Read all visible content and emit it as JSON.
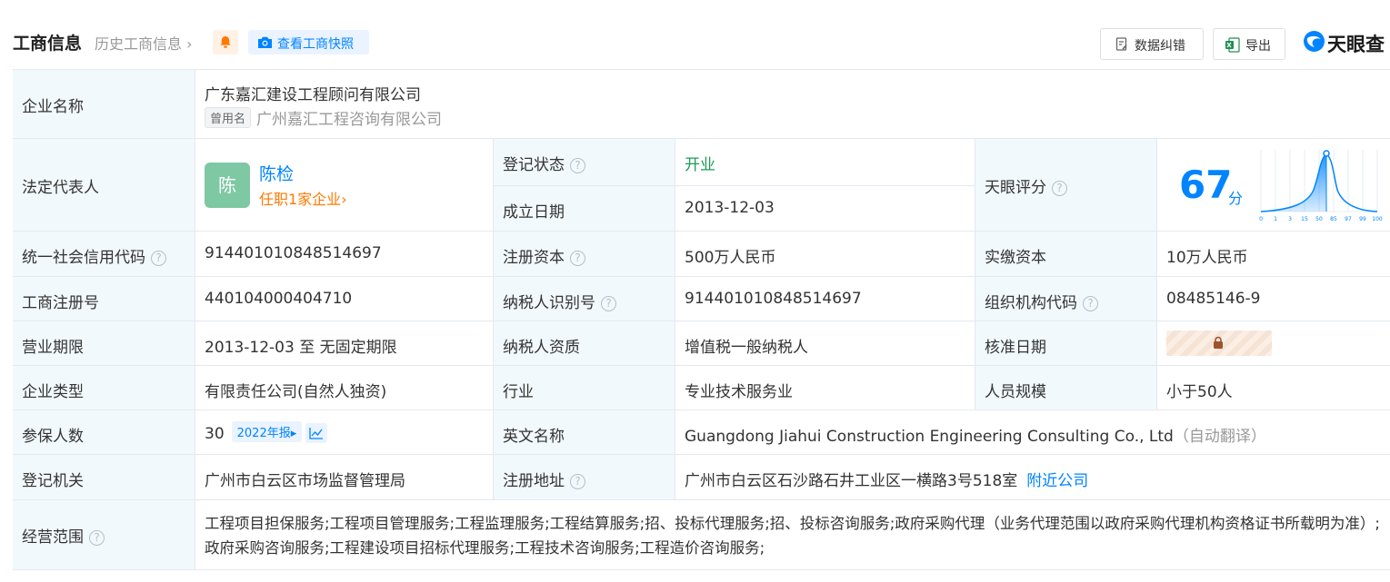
{
  "header": {
    "title": "工商信息",
    "history": "历史工商信息",
    "snapshot": "查看工商快照",
    "correct": "数据纠错",
    "export": "导出",
    "brand": "天眼查"
  },
  "company": {
    "label": "企业名称",
    "name": "广东嘉汇建设工程顾问有限公司",
    "former_tag": "曾用名",
    "former_name": "广州嘉汇工程咨询有限公司"
  },
  "rep": {
    "label": "法定代表人",
    "avatar": "陈",
    "name": "陈检",
    "sub": "任职1家企业"
  },
  "status": {
    "label": "登记状态",
    "value": "开业",
    "color": "#1c9c56"
  },
  "established": {
    "label": "成立日期",
    "value": "2013-12-03"
  },
  "score": {
    "label": "天眼评分",
    "value": "67",
    "unit": "分",
    "axis": [
      "0",
      "1",
      "3",
      "15",
      "50",
      "85",
      "97",
      "99",
      "100"
    ]
  },
  "credit_code": {
    "label": "统一社会信用代码",
    "value": "914401010848514697"
  },
  "reg_capital": {
    "label": "注册资本",
    "value": "500万人民币"
  },
  "paid_capital": {
    "label": "实缴资本",
    "value": "10万人民币"
  },
  "reg_no": {
    "label": "工商注册号",
    "value": "440104000404710"
  },
  "taxpayer_id": {
    "label": "纳税人识别号",
    "value": "914401010848514697"
  },
  "org_code": {
    "label": "组织机构代码",
    "value": "08485146-9"
  },
  "term": {
    "label": "营业期限",
    "value": "2013-12-03 至 无固定期限"
  },
  "taxpayer_qual": {
    "label": "纳税人资质",
    "value": "增值税一般纳税人"
  },
  "approval_date": {
    "label": "核准日期"
  },
  "type": {
    "label": "企业类型",
    "value": "有限责任公司(自然人独资)"
  },
  "industry": {
    "label": "行业",
    "value": "专业技术服务业"
  },
  "staff_size": {
    "label": "人员规模",
    "value": "小于50人"
  },
  "insured": {
    "label": "参保人数",
    "value": "30",
    "year_tag": "2022年报"
  },
  "english_name": {
    "label": "英文名称",
    "value": "Guangdong Jiahui Construction Engineering Consulting Co., Ltd",
    "note": "（自动翻译）"
  },
  "authority": {
    "label": "登记机关",
    "value": "广州市白云区市场监督管理局"
  },
  "address": {
    "label": "注册地址",
    "value": "广州市白云区石沙路石井工业区一横路3号518室",
    "nearby": "附近公司"
  },
  "scope": {
    "label": "经营范围",
    "value": "工程项目担保服务;工程项目管理服务;工程监理服务;工程结算服务;招、投标代理服务;招、投标咨询服务;政府采购代理（业务代理范围以政府采购代理机构资格证书所载明为准）;政府采购咨询服务;工程建设项目招标代理服务;工程技术咨询服务;工程造价咨询服务;"
  }
}
